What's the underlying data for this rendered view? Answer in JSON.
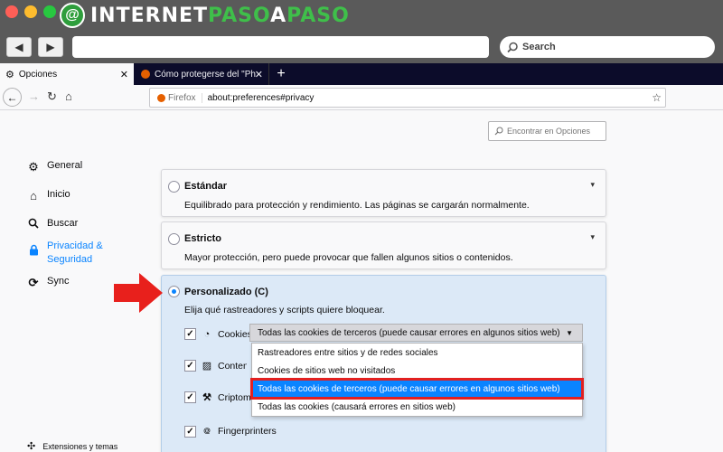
{
  "brand": {
    "logo_letter": "@",
    "name_a": "INTERNET",
    "name_b": "PASO",
    "name_c": "A",
    "name_d": "PASO"
  },
  "colors": {
    "accent": "#0a84ff",
    "highlight_border": "#e22020",
    "brand_green": "#3fbf4a"
  },
  "outer_toolbar": {
    "search_label": "Search"
  },
  "tabs": [
    {
      "label": "Opciones",
      "active": true
    },
    {
      "label": "Cómo protegerse del \"Phishing\"",
      "active": false
    }
  ],
  "address": {
    "browser_label": "Firefox",
    "url": "about:preferences#privacy"
  },
  "find": {
    "placeholder": "Encontrar en Opciones"
  },
  "sidebar": {
    "items": [
      {
        "label": "General",
        "icon": "gear-icon"
      },
      {
        "label": "Inicio",
        "icon": "home-icon"
      },
      {
        "label": "Buscar",
        "icon": "search-icon"
      },
      {
        "label_line1": "Privacidad &",
        "label_line2": "Seguridad",
        "icon": "lock-icon",
        "active": true
      },
      {
        "label": "Sync",
        "icon": "sync-icon"
      }
    ],
    "footer": "Extensiones y temas"
  },
  "cards": {
    "standard": {
      "title": "Estándar",
      "desc": "Equilibrado para protección y rendimiento. Las páginas se cargarán normalmente."
    },
    "strict": {
      "title": "Estricto",
      "desc": "Mayor protección, pero puede provocar que fallen algunos sitios o contenidos."
    },
    "custom": {
      "title": "Personalizado (C)",
      "desc": "Elija qué rastreadores y scripts quiere bloquear."
    }
  },
  "checks": [
    {
      "label": "Cookies",
      "icon": "cookie-icon"
    },
    {
      "label": "Contenido",
      "icon": "tracking-content-icon"
    },
    {
      "label": "Criptomineros",
      "icon": "cryptominer-icon"
    },
    {
      "label": "Fingerprinters",
      "icon": "fingerprint-icon"
    }
  ],
  "cookie_select": {
    "selected": "Todas las cookies de terceros (puede causar errores en algunos sitios web)",
    "options": [
      "Rastreadores entre sitios y de redes sociales",
      "Cookies de sitios web no visitados",
      "Todas las cookies de terceros (puede causar errores en algunos sitios web)",
      "Todas las cookies (causará errores en sitios web)"
    ]
  }
}
